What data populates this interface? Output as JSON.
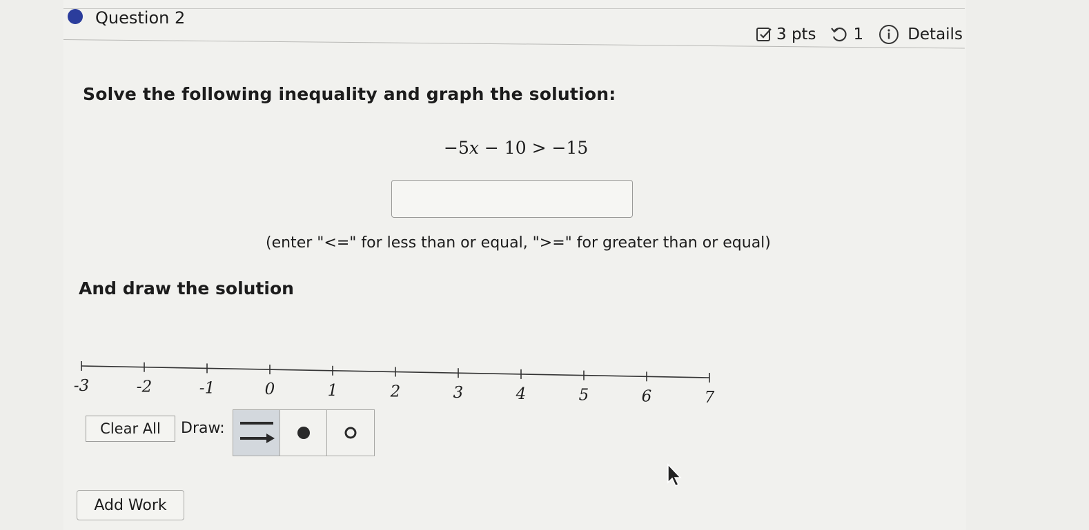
{
  "question": {
    "title": "Question 2",
    "points": "3 pts",
    "attempts": "1",
    "details_label": "Details",
    "accent_color": "#2b3d9c"
  },
  "problem": {
    "prompt": "Solve the following inequality and graph the solution:",
    "equation": {
      "coefficient": "−5",
      "variable": "x",
      "rest": " − 10 > −15"
    },
    "answer_value": "",
    "hint": "(enter \"<=\" for less than or equal, \">=\" for greater than or equal)",
    "draw_heading": "And draw the solution"
  },
  "number_line": {
    "tick_labels": [
      "-3",
      "-2",
      "-1",
      "0",
      "1",
      "2",
      "3",
      "4",
      "5",
      "6",
      "7"
    ]
  },
  "draw_tools": {
    "clear_all_label": "Clear All",
    "draw_label": "Draw:",
    "tools": [
      "ray-arrow-icon",
      "closed-dot-icon",
      "open-dot-icon"
    ],
    "selected_tool": "ray-arrow-icon"
  },
  "add_work_label": "Add Work"
}
